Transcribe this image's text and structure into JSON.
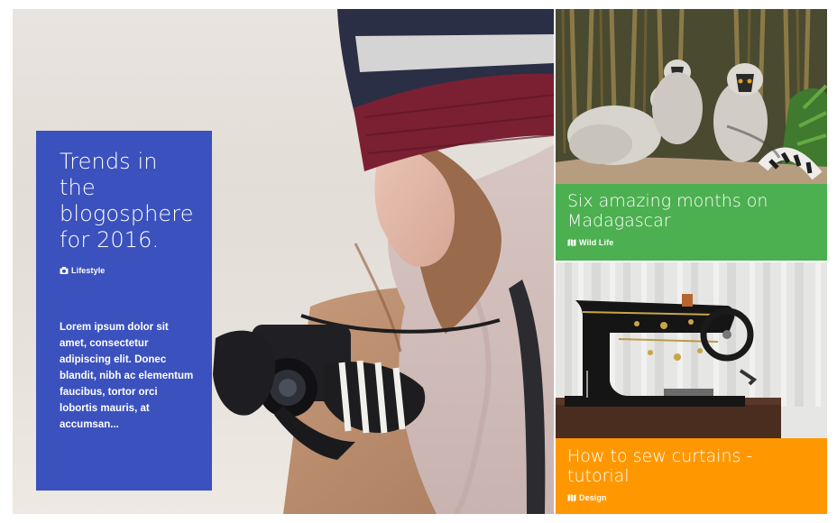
{
  "hero": {
    "title": "Trends in the blogosphere for 2016.",
    "category": "Lifestyle",
    "category_icon": "camera-icon",
    "excerpt": "Lorem ipsum dolor sit amet, consectetur adipiscing elit. Donec blandit, nibh ac elementum faucibus, tortor orci lobortis mauris, at accumsan...",
    "card_color": "#3b51bd"
  },
  "side_cards": [
    {
      "title": "Six amazing months on Madagascar",
      "category": "Wild Life",
      "category_icon": "map-icon",
      "color": "#4caf50"
    },
    {
      "title": "How to sew curtains - tutorial",
      "category": "Design",
      "category_icon": "map-icon",
      "color": "#ff9800"
    }
  ]
}
